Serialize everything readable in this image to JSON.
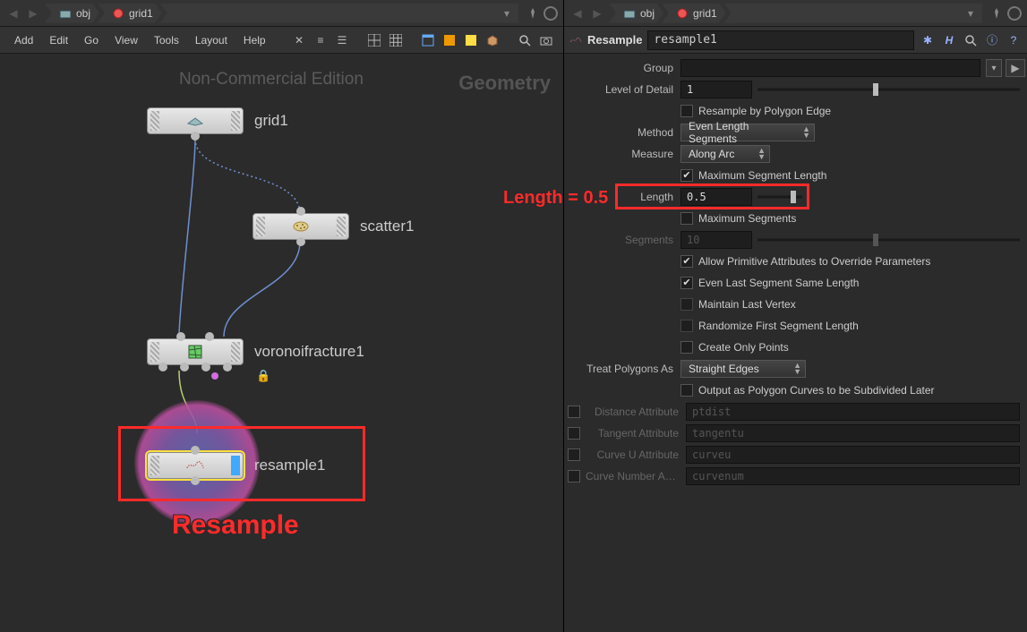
{
  "left": {
    "breadcrumb": {
      "obj": "obj",
      "grid1": "grid1"
    },
    "menu": {
      "add": "Add",
      "edit": "Edit",
      "go": "Go",
      "view": "View",
      "tools": "Tools",
      "layout": "Layout",
      "help": "Help"
    },
    "watermark": "Non-Commercial Edition",
    "context_label": "Geometry",
    "nodes": {
      "grid1": "grid1",
      "scatter1": "scatter1",
      "voronoi": "voronoifracture1",
      "resample1": "resample1"
    },
    "annotations": {
      "length_label": "Length = 0.5",
      "resample_label": "Resample"
    }
  },
  "right": {
    "breadcrumb": {
      "obj": "obj",
      "grid1": "grid1"
    },
    "op_type": "Resample",
    "node_name": "resample1",
    "params": {
      "group_label": "Group",
      "group_value": "",
      "lod_label": "Level of Detail",
      "lod_value": "1",
      "resample_poly_edge": "Resample by Polygon Edge",
      "method_label": "Method",
      "method_value": "Even Length Segments",
      "measure_label": "Measure",
      "measure_value": "Along Arc",
      "max_seg_len": "Maximum Segment Length",
      "length_label": "Length",
      "length_value": "0.5",
      "max_segments": "Maximum Segments",
      "segments_label": "Segments",
      "segments_value": "10",
      "allow_prim_override": "Allow Primitive Attributes to Override Parameters",
      "even_last": "Even Last Segment Same Length",
      "maintain_last": "Maintain Last Vertex",
      "randomize_first": "Randomize First Segment Length",
      "create_only_points": "Create Only Points",
      "treat_poly_label": "Treat Polygons As",
      "treat_poly_value": "Straight Edges",
      "output_curves": "Output as Polygon Curves to be Subdivided Later",
      "dist_attr_label": "Distance Attribute",
      "dist_attr_value": "ptdist",
      "tan_attr_label": "Tangent Attribute",
      "tan_attr_value": "tangentu",
      "curveu_label": "Curve U Attribute",
      "curveu_value": "curveu",
      "curvenum_label": "Curve Number Attr…",
      "curvenum_value": "curvenum"
    }
  }
}
